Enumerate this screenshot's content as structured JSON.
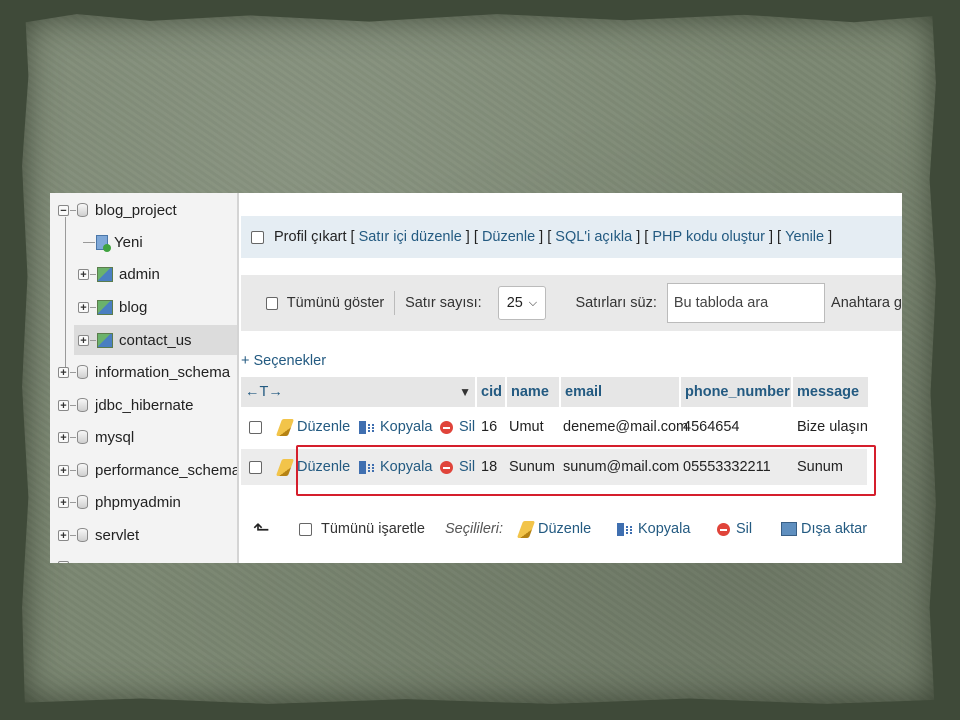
{
  "sidebar": {
    "items": [
      {
        "label": "blog_project",
        "type": "db",
        "state": "expanded"
      },
      {
        "label": "Yeni",
        "type": "new"
      },
      {
        "label": "admin",
        "type": "view"
      },
      {
        "label": "blog",
        "type": "view"
      },
      {
        "label": "contact_us",
        "type": "view",
        "selected": true
      },
      {
        "label": "information_schema",
        "type": "db"
      },
      {
        "label": "jdbc_hibernate",
        "type": "db"
      },
      {
        "label": "mysql",
        "type": "db"
      },
      {
        "label": "performance_schema",
        "type": "db"
      },
      {
        "label": "phpmyadmin",
        "type": "db"
      },
      {
        "label": "servlet",
        "type": "db"
      }
    ]
  },
  "profil_bar": {
    "profil_label": "Profil çıkart",
    "links": [
      "Satır içi düzenle",
      "Düzenle",
      "SQL'i açıkla",
      "PHP kodu oluştur",
      "Yenile"
    ]
  },
  "filter_bar": {
    "show_all_label": "Tümünü göster",
    "row_count_label": "Satır sayısı:",
    "row_count_value": "25",
    "filter_label": "Satırları süz:",
    "search_placeholder": "Bu tabloda ara",
    "key_label": "Anahtara g"
  },
  "options_link": "+ Seçenekler",
  "table": {
    "sort_arrows": "←T→",
    "sort_marker": "▼",
    "columns": [
      "cid",
      "name",
      "email",
      "phone_number",
      "message"
    ],
    "action_labels": {
      "edit": "Düzenle",
      "copy": "Kopyala",
      "delete": "Sil"
    },
    "rows": [
      {
        "cid": "16",
        "name": "Umut",
        "email": "deneme@mail.com",
        "phone_number": "4564654",
        "message": "Bize ulaşın"
      },
      {
        "cid": "18",
        "name": "Sunum",
        "email": "sunum@mail.com",
        "phone_number": "05553332211",
        "message": "Sunum",
        "highlighted": true
      }
    ]
  },
  "bottom_bar": {
    "select_all_label": "Tümünü işaretle",
    "selected_label": "Seçilileri:",
    "edit_label": "Düzenle",
    "copy_label": "Kopyala",
    "delete_label": "Sil",
    "export_label": "Dışa aktar"
  },
  "colors": {
    "link": "#235a81",
    "highlight_border": "#d51e2c",
    "slide_background": "#7b8772"
  }
}
